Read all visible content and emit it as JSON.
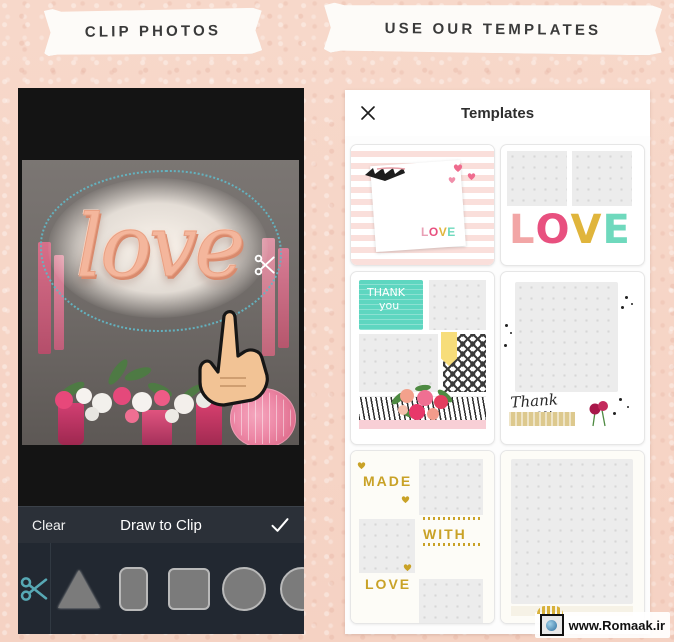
{
  "background": {
    "color": "#f7d8ca",
    "texture": "paper-grain"
  },
  "headers": {
    "left_tape": "CLIP PHOTOS",
    "right_tape": "USE OUR TEMPLATES"
  },
  "left_panel": {
    "photo": {
      "subject_text": "love",
      "description": "rose-gold love balloon photo",
      "selection_outline_color": "#63b6c4"
    },
    "cursors": {
      "scissors": "scissors-cursor",
      "hand": "pointing-hand-cursor"
    },
    "toolbar": {
      "clear_label": "Clear",
      "title": "Draw to Clip",
      "confirm_icon": "checkmark-icon"
    },
    "shape_tools": {
      "active_icon": "scissors-icon",
      "active_color": "#57a9b5",
      "shapes": [
        {
          "name": "triangle-shape-tool"
        },
        {
          "name": "rounded-rect-shape-tool"
        },
        {
          "name": "square-shape-tool"
        },
        {
          "name": "circle-shape-tool"
        },
        {
          "name": "circle-partial-shape-tool"
        }
      ]
    }
  },
  "right_panel": {
    "header": {
      "close_icon": "close-icon",
      "title": "Templates"
    },
    "templates": [
      {
        "id": "striped-love-card",
        "texts": {
          "love": "LOVE"
        },
        "colors": {
          "stripe": "#fadfdb",
          "heart": "#ef6b8e"
        }
      },
      {
        "id": "big-love-blocks",
        "texts": {
          "love": "LOVE"
        },
        "letter_colors": {
          "L": "#f2a6a6",
          "O": "#e8507f",
          "V": "#e0b53c",
          "E": "#6fd9bd"
        }
      },
      {
        "id": "thank-you-mint",
        "texts": {
          "line1": "THANK",
          "line2": "you"
        },
        "colors": {
          "mint": "#5ed6c0",
          "banner": "#f7dd7a",
          "pink_strip": "#f8cfd6"
        }
      },
      {
        "id": "thank-you-script",
        "texts": {
          "line1": "Thank",
          "line2": "you"
        },
        "colors": {
          "tape": "#ddc98e",
          "flower": "#b02050"
        }
      },
      {
        "id": "made-with-love-gold",
        "texts": {
          "word1": "MADE",
          "word2": "WITH",
          "word3": "LOVE"
        },
        "colors": {
          "gold": "#c9a227"
        }
      },
      {
        "id": "plain-dot-frame",
        "texts": {},
        "colors": {
          "frame": "#f6f2e6"
        }
      }
    ]
  },
  "watermark": {
    "text": "www.Romaak.ir",
    "logo_icon": "globe-logo-icon"
  }
}
